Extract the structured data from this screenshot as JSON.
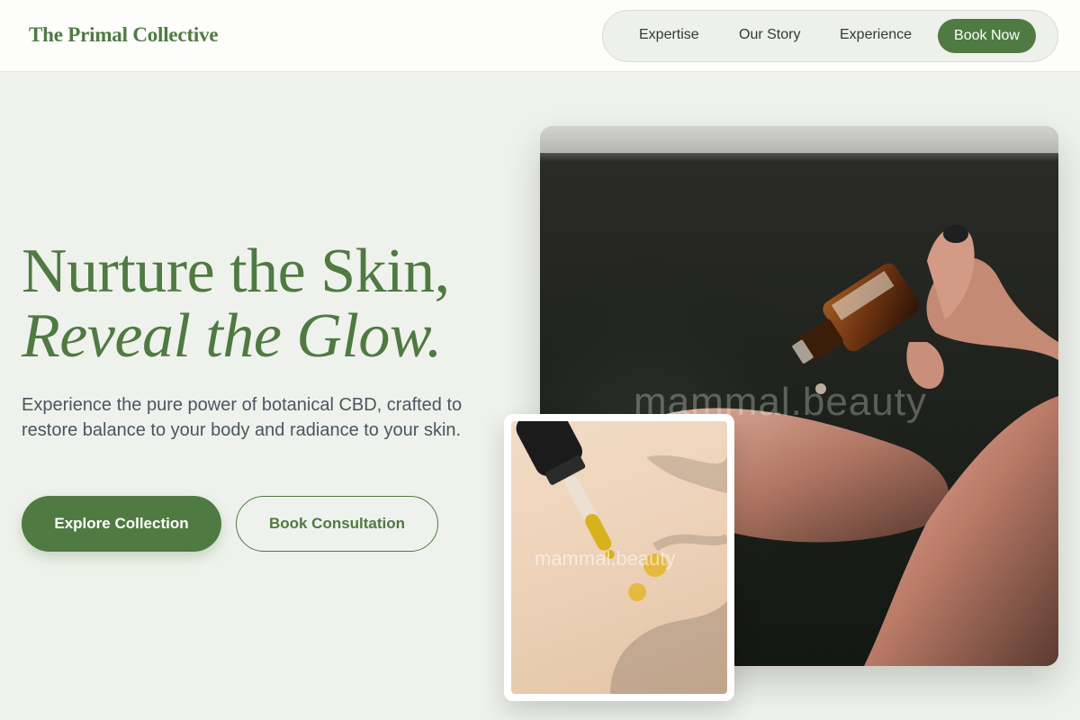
{
  "header": {
    "logo": "The Primal Collective",
    "nav": [
      {
        "label": "Expertise"
      },
      {
        "label": "Our Story"
      },
      {
        "label": "Experience"
      }
    ],
    "cta_label": "Book Now"
  },
  "hero": {
    "headline_line1": "Nurture the Skin,",
    "headline_line2": "Reveal the Glow.",
    "subtitle": "Experience the pure power of botanical CBD, crafted to restore balance to your body and radiance to your skin.",
    "primary_button": "Explore Collection",
    "secondary_button": "Book Consultation"
  },
  "images": {
    "main_watermark": "mammal.beauty",
    "inset_watermark": "mammal.beauty"
  },
  "colors": {
    "brand_green": "#4f7a42",
    "page_background": "#eff2ec",
    "header_background": "#fdfdfc"
  }
}
